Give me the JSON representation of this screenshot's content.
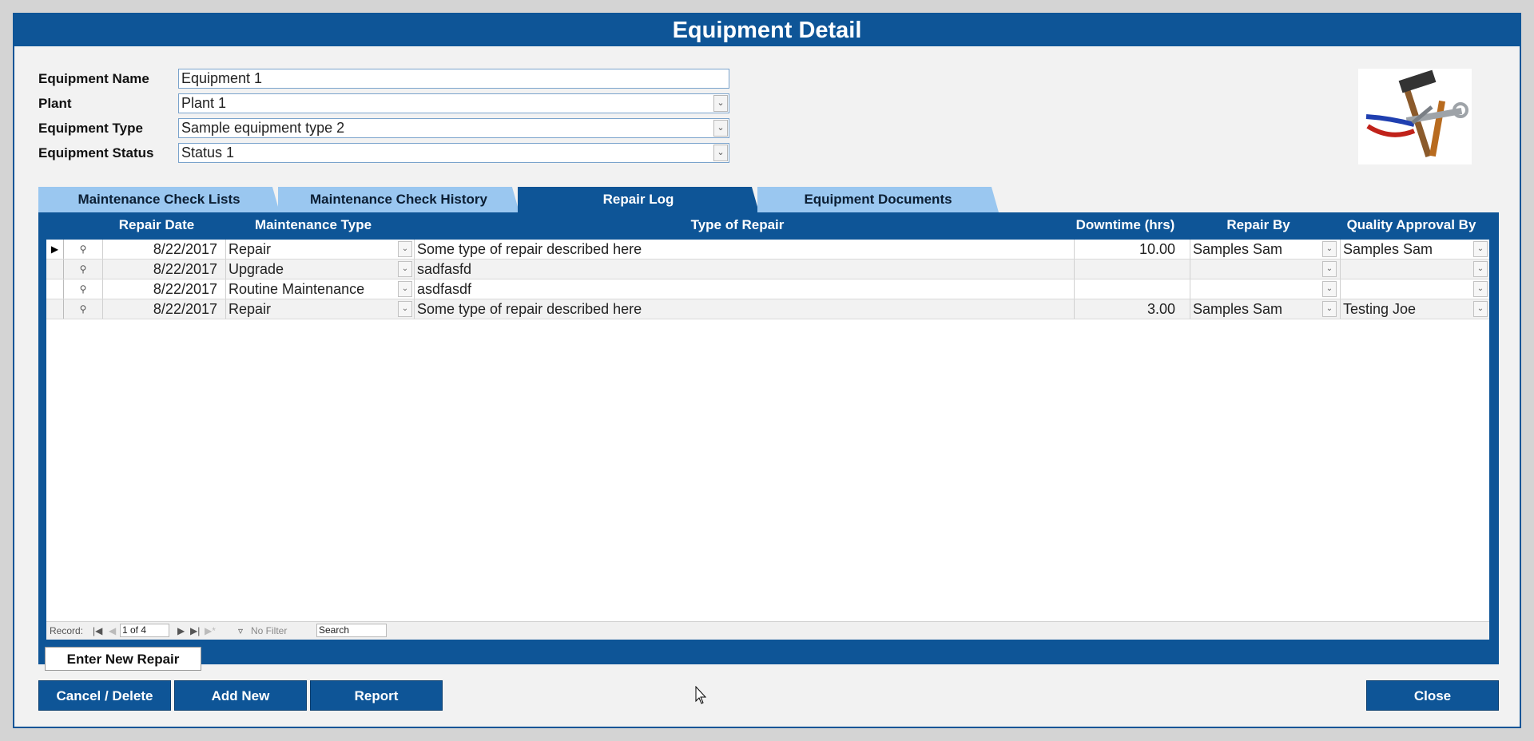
{
  "window": {
    "title": "Equipment Detail"
  },
  "form": {
    "name_label": "Equipment Name",
    "name_value": "Equipment 1",
    "plant_label": "Plant",
    "plant_value": "Plant 1",
    "type_label": "Equipment Type",
    "type_value": "Sample equipment type 2",
    "status_label": "Equipment Status",
    "status_value": "Status 1"
  },
  "tabs": [
    {
      "label": "Maintenance Check Lists",
      "active": false
    },
    {
      "label": "Maintenance Check History",
      "active": false
    },
    {
      "label": "Repair Log",
      "active": true
    },
    {
      "label": "Equipment Documents",
      "active": false
    }
  ],
  "grid": {
    "columns": [
      "Repair Date",
      "Maintenance Type",
      "Type of Repair",
      "Downtime (hrs)",
      "Repair By",
      "Quality Approval By"
    ],
    "rows": [
      {
        "date": "8/22/2017",
        "maint": "Repair",
        "repair": "Some type of repair described here",
        "downtime": "10.00",
        "by": "Samples Sam",
        "qa": "Samples Sam"
      },
      {
        "date": "8/22/2017",
        "maint": "Upgrade",
        "repair": "sadfasfd",
        "downtime": "",
        "by": "",
        "qa": ""
      },
      {
        "date": "8/22/2017",
        "maint": "Routine Maintenance",
        "repair": "asdfasdf",
        "downtime": "",
        "by": "",
        "qa": ""
      },
      {
        "date": "8/22/2017",
        "maint": "Repair",
        "repair": "Some type of repair described here",
        "downtime": "3.00",
        "by": "Samples Sam",
        "qa": "Testing Joe"
      }
    ]
  },
  "navigation": {
    "record_label": "Record:",
    "record_value": "1 of 4",
    "filter_label": "No Filter",
    "search_label": "Search"
  },
  "buttons": {
    "enter_new_repair": "Enter New Repair",
    "cancel_delete": "Cancel / Delete",
    "add_new": "Add New",
    "report": "Report",
    "close": "Close"
  },
  "icons": {
    "dropdown": "chevron-down-icon",
    "record_selector": "triangle-right-icon",
    "row_detail": "magnifier-icon",
    "logo": "tools-logo"
  },
  "colors": {
    "accent": "#0e5597",
    "tab_inactive": "#9ac7f0"
  }
}
